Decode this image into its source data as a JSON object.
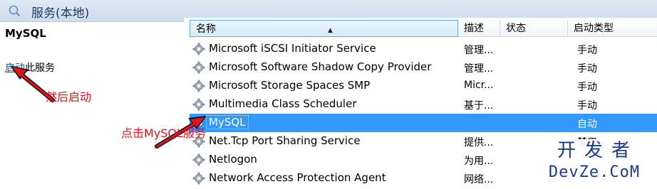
{
  "window": {
    "title": "服务(本地)",
    "icon": "magnifier-services-icon"
  },
  "left_pane": {
    "service_name": "MySQL",
    "start_link": "启动",
    "start_suffix": "此服务"
  },
  "columns": {
    "name": "名称",
    "description": "描述",
    "status": "状态",
    "startup_type": "启动类型"
  },
  "rows": [
    {
      "name": "Microsoft iSCSI Initiator Service",
      "description": "管理...",
      "status": "",
      "startup": "手动"
    },
    {
      "name": "Microsoft Software Shadow Copy Provider",
      "description": "管理...",
      "status": "",
      "startup": "手动"
    },
    {
      "name": "Microsoft Storage Spaces SMP",
      "description": "Micr...",
      "status": "",
      "startup": "手动"
    },
    {
      "name": "Multimedia Class Scheduler",
      "description": "基于...",
      "status": "",
      "startup": "手动"
    },
    {
      "name": "MySQL",
      "description": "",
      "status": "",
      "startup": "自动",
      "selected": true
    },
    {
      "name": "Net.Tcp Port Sharing Service",
      "description": "提供...",
      "status": "",
      "startup": "禁用"
    },
    {
      "name": "Netlogon",
      "description": "为用...",
      "status": "",
      "startup": ""
    },
    {
      "name": "Network Access Protection Agent",
      "description": "网络...",
      "status": "",
      "startup": ""
    }
  ],
  "annotations": {
    "then_start": "然后启动",
    "click_mysql": "点击MySQL服务"
  },
  "watermark": {
    "line1": "开发者",
    "line2": "DevZe.CoM"
  },
  "colors": {
    "selection": "#3399ff",
    "annotation": "#e0141e",
    "link": "#0066cc",
    "watermark": "#1a3a8a"
  },
  "icons": {
    "service": "gear-icon"
  }
}
